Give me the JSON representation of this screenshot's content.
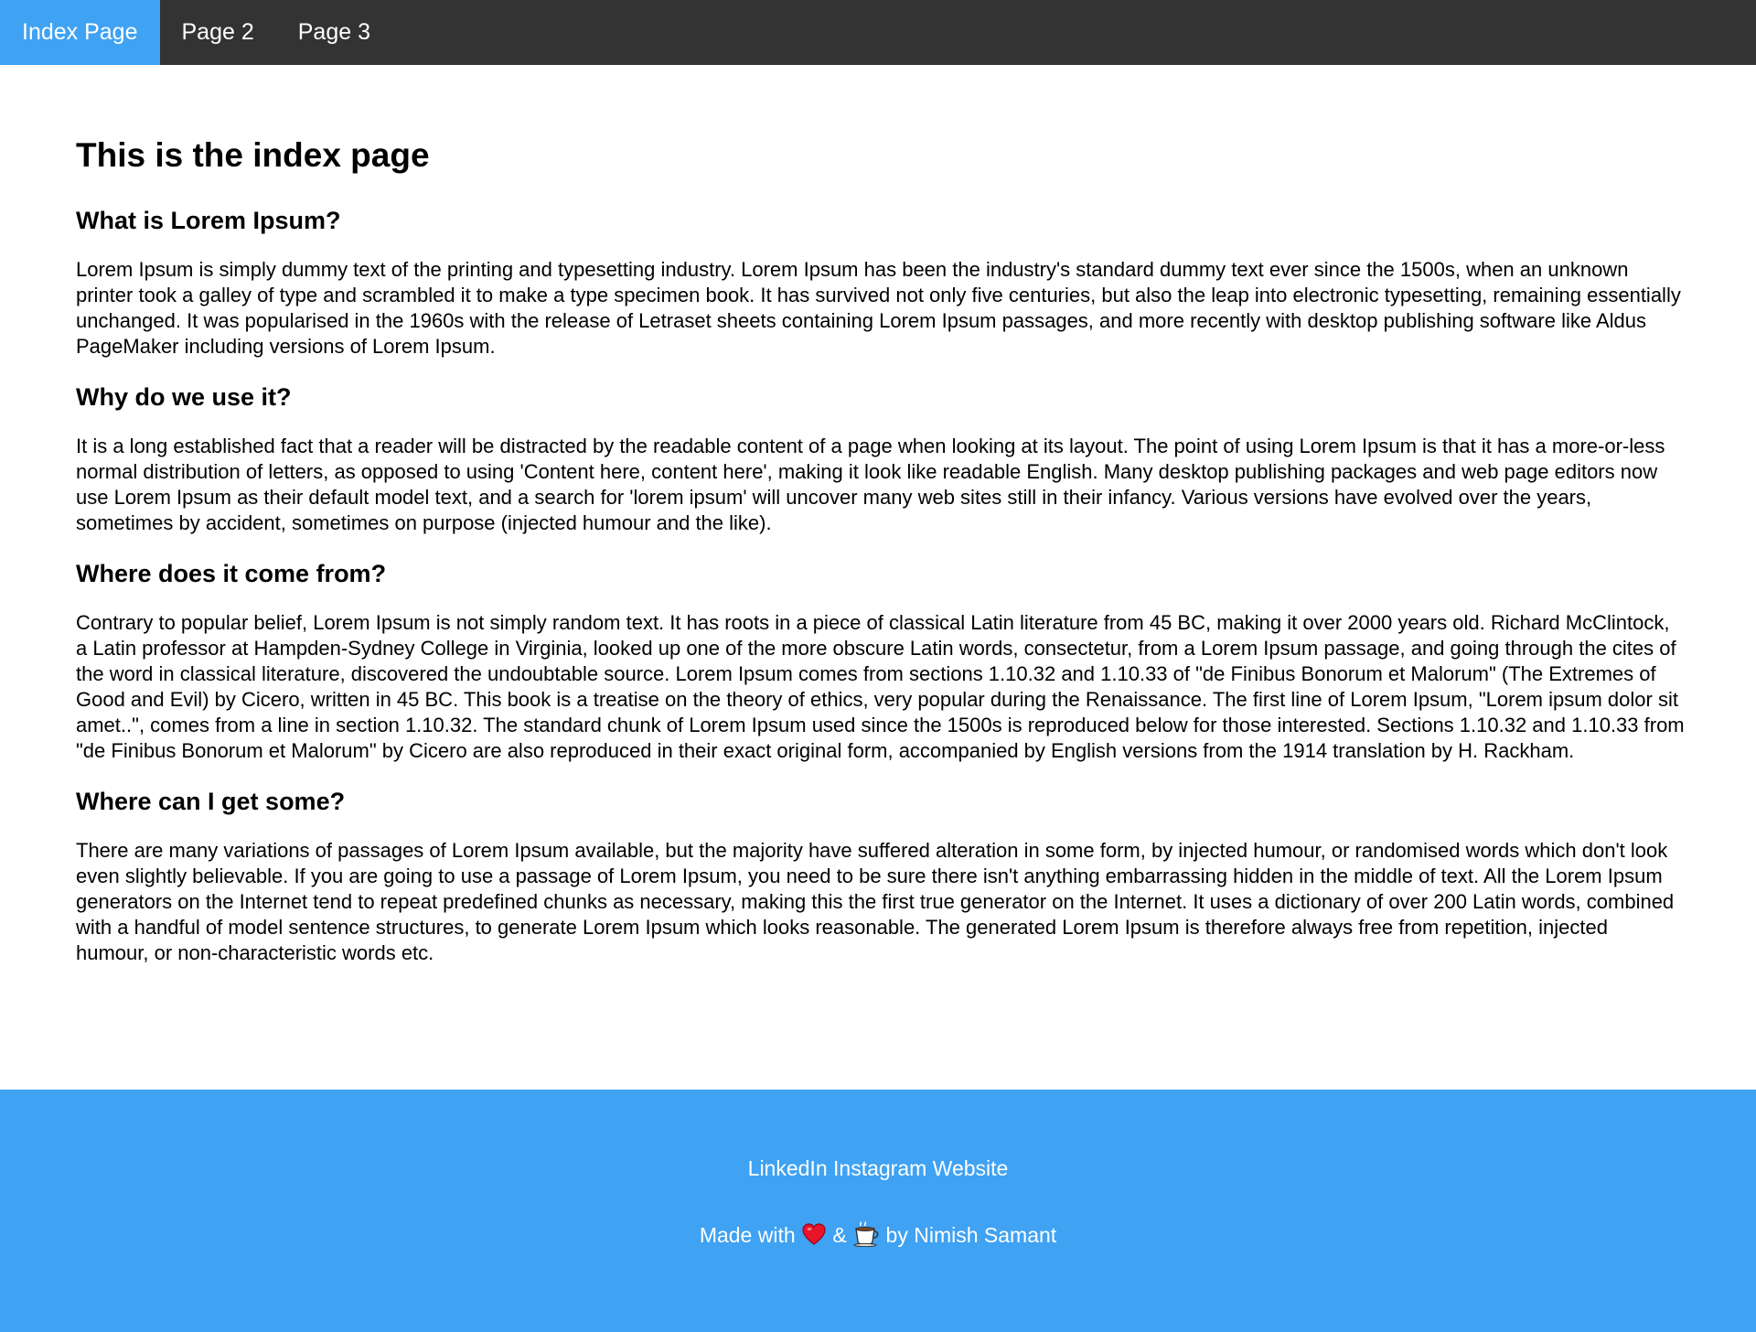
{
  "nav": {
    "items": [
      {
        "label": "Index Page",
        "active": true
      },
      {
        "label": "Page 2",
        "active": false
      },
      {
        "label": "Page 3",
        "active": false
      }
    ]
  },
  "main": {
    "title": "This is the index page",
    "sections": [
      {
        "heading": "What is Lorem Ipsum?",
        "body": "Lorem Ipsum is simply dummy text of the printing and typesetting industry. Lorem Ipsum has been the industry's standard dummy text ever since the 1500s, when an unknown printer took a galley of type and scrambled it to make a type specimen book. It has survived not only five centuries, but also the leap into electronic typesetting, remaining essentially unchanged. It was popularised in the 1960s with the release of Letraset sheets containing Lorem Ipsum passages, and more recently with desktop publishing software like Aldus PageMaker including versions of Lorem Ipsum."
      },
      {
        "heading": "Why do we use it?",
        "body": "It is a long established fact that a reader will be distracted by the readable content of a page when looking at its layout. The point of using Lorem Ipsum is that it has a more-or-less normal distribution of letters, as opposed to using 'Content here, content here', making it look like readable English. Many desktop publishing packages and web page editors now use Lorem Ipsum as their default model text, and a search for 'lorem ipsum' will uncover many web sites still in their infancy. Various versions have evolved over the years, sometimes by accident, sometimes on purpose (injected humour and the like)."
      },
      {
        "heading": "Where does it come from?",
        "body": "Contrary to popular belief, Lorem Ipsum is not simply random text. It has roots in a piece of classical Latin literature from 45 BC, making it over 2000 years old. Richard McClintock, a Latin professor at Hampden-Sydney College in Virginia, looked up one of the more obscure Latin words, consectetur, from a Lorem Ipsum passage, and going through the cites of the word in classical literature, discovered the undoubtable source. Lorem Ipsum comes from sections 1.10.32 and 1.10.33 of \"de Finibus Bonorum et Malorum\" (The Extremes of Good and Evil) by Cicero, written in 45 BC. This book is a treatise on the theory of ethics, very popular during the Renaissance. The first line of Lorem Ipsum, \"Lorem ipsum dolor sit amet..\", comes from a line in section 1.10.32. The standard chunk of Lorem Ipsum used since the 1500s is reproduced below for those interested. Sections 1.10.32 and 1.10.33 from \"de Finibus Bonorum et Malorum\" by Cicero are also reproduced in their exact original form, accompanied by English versions from the 1914 translation by H. Rackham."
      },
      {
        "heading": "Where can I get some?",
        "body": "There are many variations of passages of Lorem Ipsum available, but the majority have suffered alteration in some form, by injected humour, or randomised words which don't look even slightly believable. If you are going to use a passage of Lorem Ipsum, you need to be sure there isn't anything embarrassing hidden in the middle of text. All the Lorem Ipsum generators on the Internet tend to repeat predefined chunks as necessary, making this the first true generator on the Internet. It uses a dictionary of over 200 Latin words, combined with a handful of model sentence structures, to generate Lorem Ipsum which looks reasonable. The generated Lorem Ipsum is therefore always free from repetition, injected humour, or non-characteristic words etc."
      }
    ]
  },
  "footer": {
    "links": [
      "LinkedIn",
      "Instagram",
      "Website"
    ],
    "credit_prefix": "Made with",
    "credit_amp": "&",
    "credit_suffix": "by Nimish Samant",
    "icons": [
      "heart-icon",
      "coffee-icon"
    ]
  },
  "colors": {
    "nav_bg": "#333333",
    "accent": "#3fa2f3",
    "text": "#000000",
    "footer_text": "#ffffff"
  }
}
